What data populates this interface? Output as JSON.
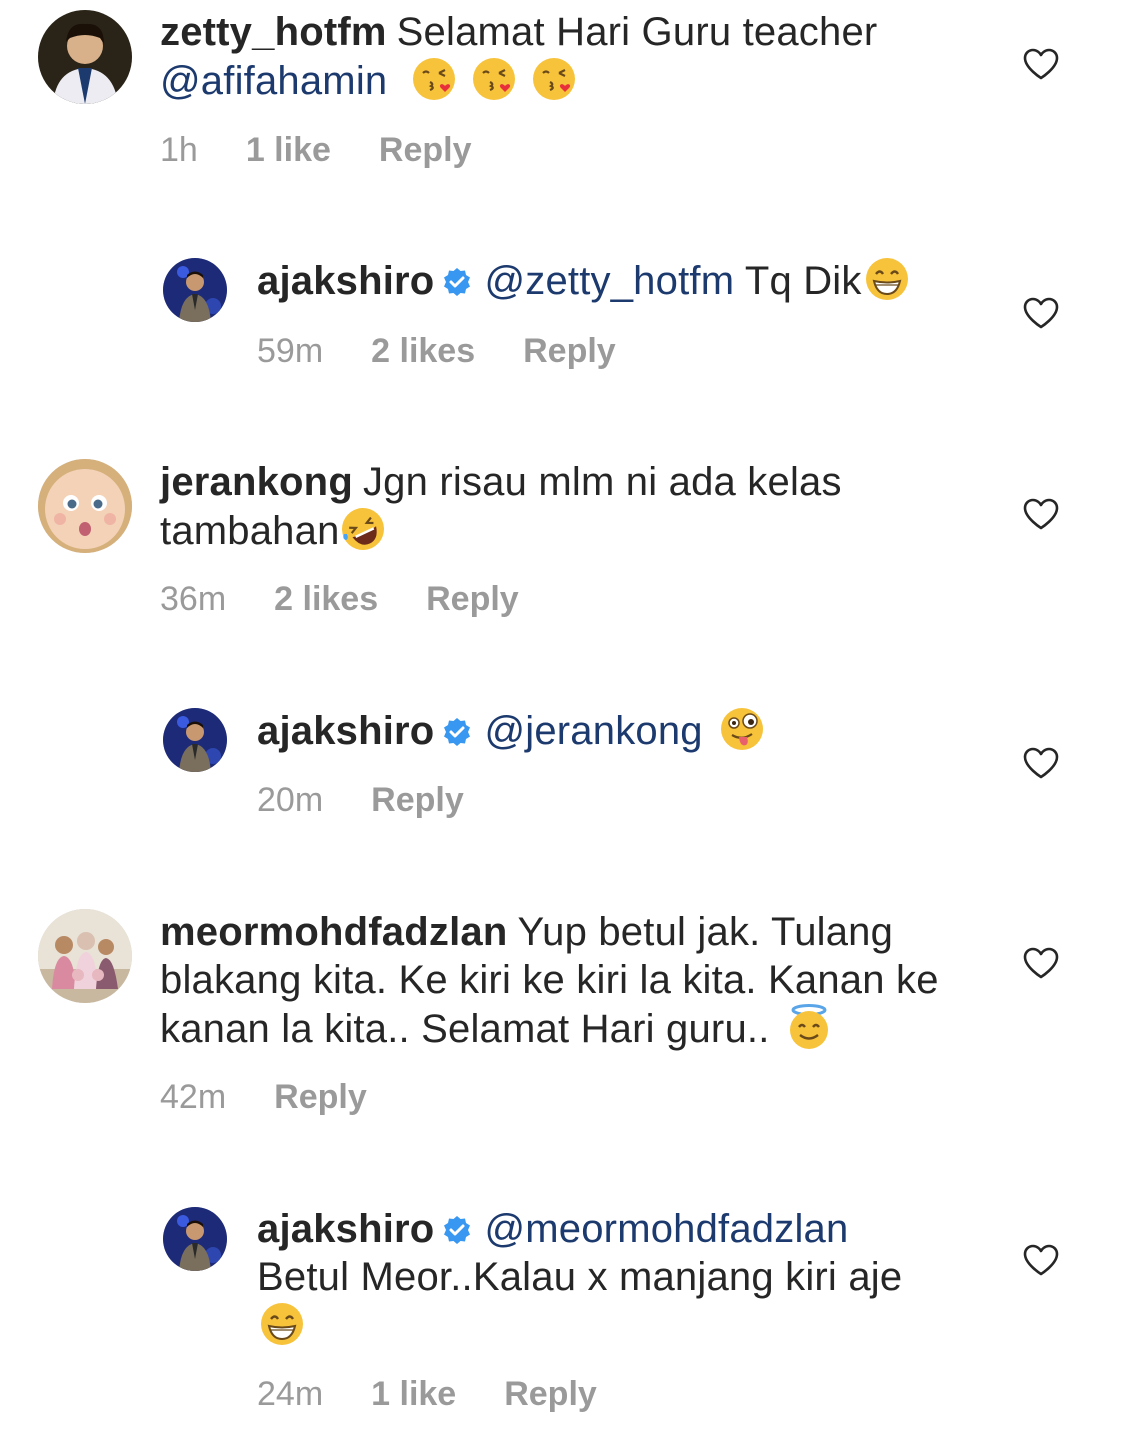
{
  "comments": [
    {
      "username": "zetty_hotfm",
      "text": "Selamat Hari Guru teacher",
      "mention": "@afifahamin",
      "emojis": [
        "kissing-heart",
        "kissing-heart",
        "kissing-heart"
      ],
      "time": "1h",
      "likes": "1 like",
      "reply_label": "Reply"
    },
    {
      "username": "ajakshiro",
      "verified": true,
      "mention": "@zetty_hotfm",
      "text": "Tq Dik",
      "emojis": [
        "grinning"
      ],
      "time": "59m",
      "likes": "2 likes",
      "reply_label": "Reply"
    },
    {
      "username": "jerankong",
      "text": "Jgn risau mlm ni ada kelas tambahan",
      "emojis": [
        "rofl"
      ],
      "time": "36m",
      "likes": "2 likes",
      "reply_label": "Reply"
    },
    {
      "username": "ajakshiro",
      "verified": true,
      "mention": "@jerankong",
      "emojis": [
        "zany"
      ],
      "time": "20m",
      "reply_label": "Reply"
    },
    {
      "username": "meormohdfadzlan",
      "text": "Yup betul jak. Tulang blakang kita. Ke kiri ke kiri la kita. Kanan ke kanan la kita.. Selamat Hari guru..",
      "emojis": [
        "halo"
      ],
      "time": "42m",
      "reply_label": "Reply"
    },
    {
      "username": "ajakshiro",
      "verified": true,
      "mention": "@meormohdfadzlan",
      "text": "Betul Meor..Kalau x manjang kiri aje",
      "emojis": [
        "grinning"
      ],
      "time": "24m",
      "likes": "1 like",
      "reply_label": "Reply"
    }
  ],
  "colors": {
    "mention": "#1c3a6e",
    "meta": "#9a9a9a",
    "verified": "#3897f0",
    "text": "#262626"
  }
}
